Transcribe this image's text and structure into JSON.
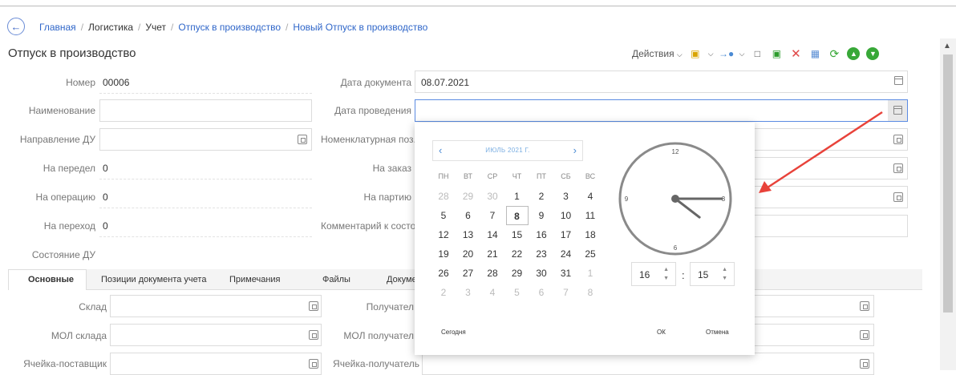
{
  "breadcrumb": {
    "items": [
      "Главная",
      "Логистика",
      "Учет",
      "Отпуск в производство",
      "Новый Отпуск в производство"
    ]
  },
  "page_title": "Отпуск в производство",
  "toolbar": {
    "actions_label": "Действия",
    "icons": [
      "clipboard-icon",
      "arrow-dot-icon",
      "new-document-icon",
      "copy-icon",
      "delete-icon",
      "calculator-icon",
      "refresh-icon",
      "upload-icon",
      "download-icon"
    ]
  },
  "form": {
    "left": {
      "number_label": "Номер",
      "number_value": "00006",
      "name_label": "Наименование",
      "direction_label": "Направление ДУ",
      "on_transfer_label": "На передел",
      "on_transfer_value": "0",
      "on_operation_label": "На операцию",
      "on_operation_value": "0",
      "on_transition_label": "На переход",
      "on_transition_value": "0",
      "state_label": "Состояние ДУ"
    },
    "right": {
      "doc_date_label": "Дата документа",
      "doc_date_value": "08.07.2021",
      "post_date_label": "Дата проведения",
      "nomenclature_label": "Номенклатурная поз...",
      "order_label": "На заказ",
      "batch_label": "На партию",
      "comment_label": "Комментарий к состоя..."
    }
  },
  "tabs": [
    "Основные",
    "Позиции документа учета",
    "Примечания",
    "Файлы",
    "Докуме"
  ],
  "tab_form": {
    "warehouse_label": "Склад",
    "receiver_label": "Получател",
    "mol_warehouse_label": "МОЛ склада",
    "mol_receiver_label": "МОЛ получател",
    "cell_supplier_label": "Ячейка-поставщик",
    "cell_receiver_label": "Ячейка-получатель"
  },
  "datepicker": {
    "month_label": "ИЮЛЬ 2021 Г.",
    "weekdays": [
      "ПН",
      "ВТ",
      "СР",
      "ЧТ",
      "ПТ",
      "СБ",
      "ВС"
    ],
    "weeks": [
      [
        "28",
        "29",
        "30",
        "1",
        "2",
        "3",
        "4"
      ],
      [
        "5",
        "6",
        "7",
        "8",
        "9",
        "10",
        "11"
      ],
      [
        "12",
        "13",
        "14",
        "15",
        "16",
        "17",
        "18"
      ],
      [
        "19",
        "20",
        "21",
        "22",
        "23",
        "24",
        "25"
      ],
      [
        "26",
        "27",
        "28",
        "29",
        "30",
        "31",
        "1"
      ],
      [
        "2",
        "3",
        "4",
        "5",
        "6",
        "7",
        "8"
      ]
    ],
    "selected_day": "8",
    "clock_labels": [
      "12",
      "3",
      "6",
      "9"
    ],
    "hour": "16",
    "minute": "15",
    "colon": ":",
    "today_label": "Сегодня",
    "ok_label": "ОК",
    "cancel_label": "Отмена"
  },
  "colors": {
    "link": "#2f66c9",
    "accent_border": "#5b8be2",
    "arrow": "#e8423a"
  }
}
